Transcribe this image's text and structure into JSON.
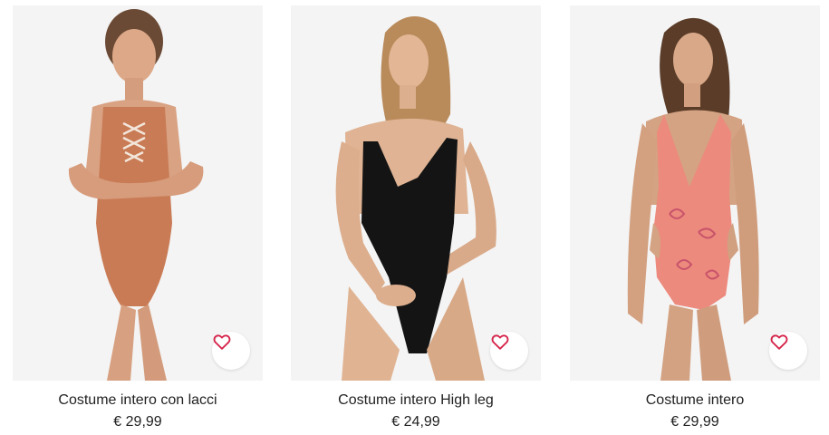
{
  "colors": {
    "heart": "#d6244a",
    "card_background": "#f3f3f3",
    "text": "#222222"
  },
  "products": [
    {
      "title": "Costume intero con lacci",
      "price": "€ 29,99",
      "image": "model-rust-lace-up-swimsuit",
      "favorite_icon": "heart-outline-icon"
    },
    {
      "title": "Costume intero High leg",
      "price": "€ 24,99",
      "image": "model-black-high-leg-swimsuit",
      "favorite_icon": "heart-outline-icon"
    },
    {
      "title": "Costume intero",
      "price": "€ 29,99",
      "image": "model-pink-paisley-swimsuit",
      "favorite_icon": "heart-outline-icon"
    }
  ]
}
